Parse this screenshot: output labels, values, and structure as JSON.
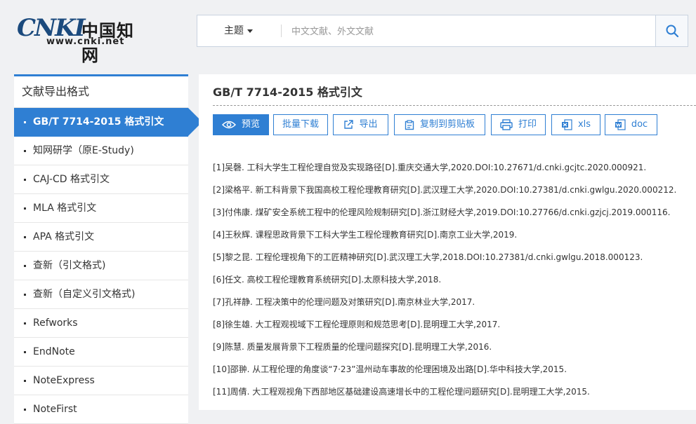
{
  "header": {
    "logo_mark": "CNKI",
    "logo_cn": "中国知网",
    "logo_url": "www.cnki.net",
    "search": {
      "scope": "主题",
      "placeholder": "中文文献、外文文献",
      "icon": "search-icon"
    }
  },
  "sidebar": {
    "title": "文献导出格式",
    "items": [
      {
        "label": "GB/T 7714-2015 格式引文",
        "active": true
      },
      {
        "label": "知网研学（原E-Study)"
      },
      {
        "label": "CAJ-CD 格式引文"
      },
      {
        "label": "MLA 格式引文"
      },
      {
        "label": "APA 格式引文"
      },
      {
        "label": "查新（引文格式)"
      },
      {
        "label": "查新（自定义引文格式)"
      },
      {
        "label": "Refworks"
      },
      {
        "label": "EndNote"
      },
      {
        "label": "NoteExpress"
      },
      {
        "label": "NoteFirst"
      }
    ],
    "accent_color": "#2f7fd3"
  },
  "main": {
    "title": "GB/T 7714-2015 格式引文",
    "toolbar": {
      "preview": "预览",
      "batch_download": "批量下载",
      "export": "导出",
      "copy": "复制到剪贴板",
      "print": "打印",
      "xls": "xls",
      "doc": "doc"
    },
    "references": [
      "[1]吴磬. 工科大学生工程伦理自觉及实现路径[D].重庆交通大学,2020.DOI:10.27671/d.cnki.gcjtc.2020.000921.",
      "[2]梁格平. 新工科背景下我国高校工程伦理教育研究[D].武汉理工大学,2020.DOI:10.27381/d.cnki.gwlgu.2020.000212.",
      "[3]付伟康. 煤矿安全系统工程中的伦理风险规制研究[D].浙江财经大学,2019.DOI:10.27766/d.cnki.gzjcj.2019.000116.",
      "[4]王秋辉. 课程思政背景下工科大学生工程伦理教育研究[D].南京工业大学,2019.",
      "[5]黎之昆. 工程伦理视角下的工匠精神研究[D].武汉理工大学,2018.DOI:10.27381/d.cnki.gwlgu.2018.000123.",
      "[6]任文. 高校工程伦理教育系统研究[D].太原科技大学,2018.",
      "[7]孔祥静. 工程决策中的伦理问题及对策研究[D].南京林业大学,2017.",
      "[8]徐生雄. 大工程观视域下工程伦理原则和规范思考[D].昆明理工大学,2017.",
      "[9]陈慧. 质量发展背景下工程质量的伦理问题探究[D].昆明理工大学,2016.",
      "[10]邵翀. 从工程伦理的角度谈“7·23”温州动车事故的伦理困境及出路[D].华中科技大学,2015.",
      "[11]周倩. 大工程观视角下西部地区基础建设高速增长中的工程伦理问题研究[D].昆明理工大学,2015."
    ]
  }
}
